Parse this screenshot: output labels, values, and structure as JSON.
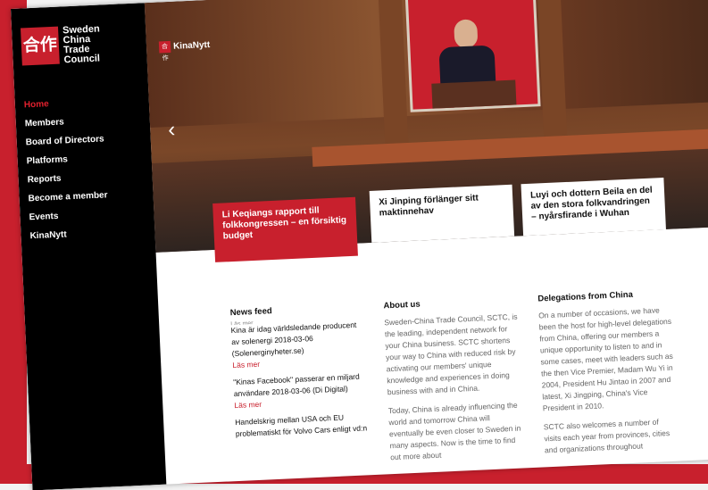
{
  "brand": {
    "logo_chars": "合作",
    "name_lines": [
      "Sweden",
      "China",
      "Trade",
      "Council"
    ]
  },
  "nav": [
    {
      "label": "Home",
      "active": true
    },
    {
      "label": "Members"
    },
    {
      "label": "Board of Directors"
    },
    {
      "label": "Platforms"
    },
    {
      "label": "Reports"
    },
    {
      "label": "Become a member"
    },
    {
      "label": "Events"
    },
    {
      "label": "KinaNytt"
    }
  ],
  "hero": {
    "label_icon": "合作",
    "label_text": "KinaNytt",
    "prev_arrow": "‹"
  },
  "cards": [
    {
      "title": "Li Keqiangs rapport till folkkongressen – en försiktig budget"
    },
    {
      "title": "Xi Jinping förlänger sitt maktinnehav"
    },
    {
      "title": "Luyi och dottern Beila en del av den stora folkvandringen – nyårsfirande i Wuhan"
    }
  ],
  "news_feed": {
    "heading": "News feed",
    "cut_line": "Läs mer",
    "items": [
      {
        "text": "Kina är idag världsledande producent av solenergi 2018-03-06 (Solenerginyheter.se)",
        "link": "Läs mer"
      },
      {
        "text": "\"Kinas Facebook\" passerar en miljard användare 2018-03-06 (Di Digital)",
        "link": "Läs mer"
      },
      {
        "text": "Handelskrig mellan USA och EU problematiskt för Volvo Cars enligt vd:n"
      }
    ]
  },
  "about": {
    "heading": "About us",
    "paragraphs": [
      "Sweden-China Trade Council, SCTC, is the leading, independent network for your China business. SCTC shortens your way to China with reduced risk by activating our members' unique knowledge and experiences in doing business with and in China.",
      "Today, China is already influencing the world and tomorrow China will eventually be even closer to Sweden in many aspects. Now is the time to find out more about"
    ]
  },
  "delegations": {
    "heading": "Delegations from China",
    "paragraphs": [
      "On a number of occasions, we have been the host for high-level delegations from China, offering our members a unique opportunity to listen to and in some cases, meet with leaders such as the then Vice Premier, Madam Wu Yi in 2004, President Hu Jintao in 2007 and latest, Xi Jingping, China's Vice President in 2010.",
      "SCTC also welcomes a number of visits each year from provinces, cities and organizations throughout"
    ]
  }
}
